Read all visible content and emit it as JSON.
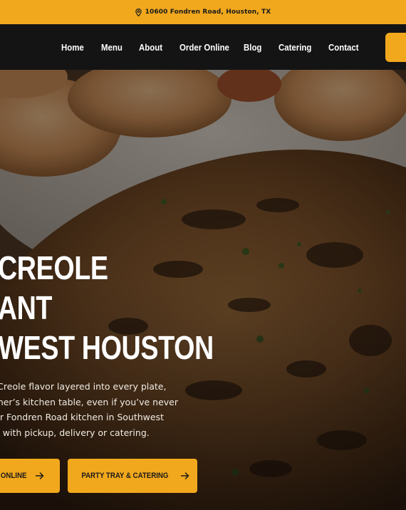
{
  "topbar": {
    "address": "10600 Fondren Road, Houston, TX",
    "icon": "map-pin-icon"
  },
  "nav": {
    "items": [
      {
        "label": "Home"
      },
      {
        "label": "Menu"
      },
      {
        "label": "About"
      },
      {
        "label": "Order Online"
      },
      {
        "label": "Blog"
      },
      {
        "label": "Catering"
      },
      {
        "label": "Contact"
      }
    ]
  },
  "hero": {
    "headline": [
      "CREOLE",
      "ANT",
      "WEST HOUSTON"
    ],
    "body_lines": [
      "d Creole flavor layered into every plate,",
      "other’s kitchen table, even if you’ve never",
      "our Fondren Road kitchen in Southwest",
      "ou with pickup, delivery or catering."
    ],
    "buttons": [
      {
        "label": "R ONLINE",
        "icon": "arrow-right-icon"
      },
      {
        "label": "PARTY TRAY & CATERING",
        "icon": "arrow-right-icon"
      }
    ]
  },
  "colors": {
    "accent": "#f2a81d",
    "nav_bg": "#141414",
    "text_light": "#ffffff"
  }
}
